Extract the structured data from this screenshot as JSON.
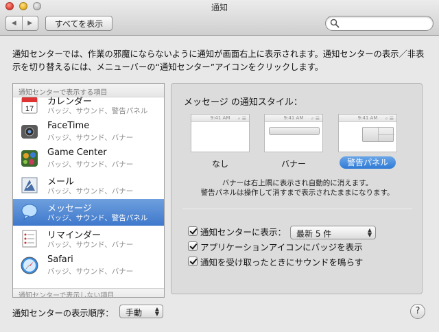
{
  "window": {
    "title": "通知"
  },
  "toolbar": {
    "show_all_label": "すべてを表示",
    "back_glyph": "◀",
    "forward_glyph": "▶"
  },
  "description": "通知センターでは、作業の邪魔にならないように通知が画面右上に表示されます。通知センターの表示／非表示を切り替えるには、メニューバーの“通知センター”アイコンをクリックします。",
  "list": {
    "header": "通知センターで表示する項目",
    "bottom_header": "通知センターで表示しない項目",
    "items": [
      {
        "name": "カレンダー",
        "sub": "バッジ、サウンド、警告パネル",
        "icon": "calendar-icon",
        "icon_text": "17"
      },
      {
        "name": "FaceTime",
        "sub": "バッジ、サウンド、バナー",
        "icon": "facetime-icon"
      },
      {
        "name": "Game Center",
        "sub": "バッジ、サウンド、バナー",
        "icon": "game-center-icon"
      },
      {
        "name": "メール",
        "sub": "バッジ、サウンド、バナー",
        "icon": "mail-icon"
      },
      {
        "name": "メッセージ",
        "sub": "バッジ、サウンド、警告パネル",
        "icon": "messages-icon",
        "selected": true
      },
      {
        "name": "リマインダー",
        "sub": "バッジ、サウンド、バナー",
        "icon": "reminders-icon"
      },
      {
        "name": "Safari",
        "sub": "バッジ、サウンド、バナー",
        "icon": "safari-icon"
      }
    ]
  },
  "panel": {
    "title": "メッセージ の通知スタイル：",
    "thumb_time": "9:41 AM",
    "styles": [
      {
        "label": "なし",
        "selected": false
      },
      {
        "label": "バナー",
        "selected": false
      },
      {
        "label": "警告パネル",
        "selected": true
      }
    ],
    "note_line1": "バナーは右上隅に表示され自動的に消えます。",
    "note_line2": "警告パネルは操作して消すまで表示されたままになります。",
    "show_in_nc_label": "通知センターに表示：",
    "show_in_nc_value": "最新 5 件",
    "badge_label": "アプリケーションアイコンにバッジを表示",
    "sound_label": "通知を受け取ったときにサウンドを鳴らす"
  },
  "footer": {
    "order_label": "通知センターの表示順序：",
    "order_value": "手動",
    "help_label": "?"
  },
  "colors": {
    "selection": "#3f79cc",
    "window_bg": "#e8e8e8"
  }
}
